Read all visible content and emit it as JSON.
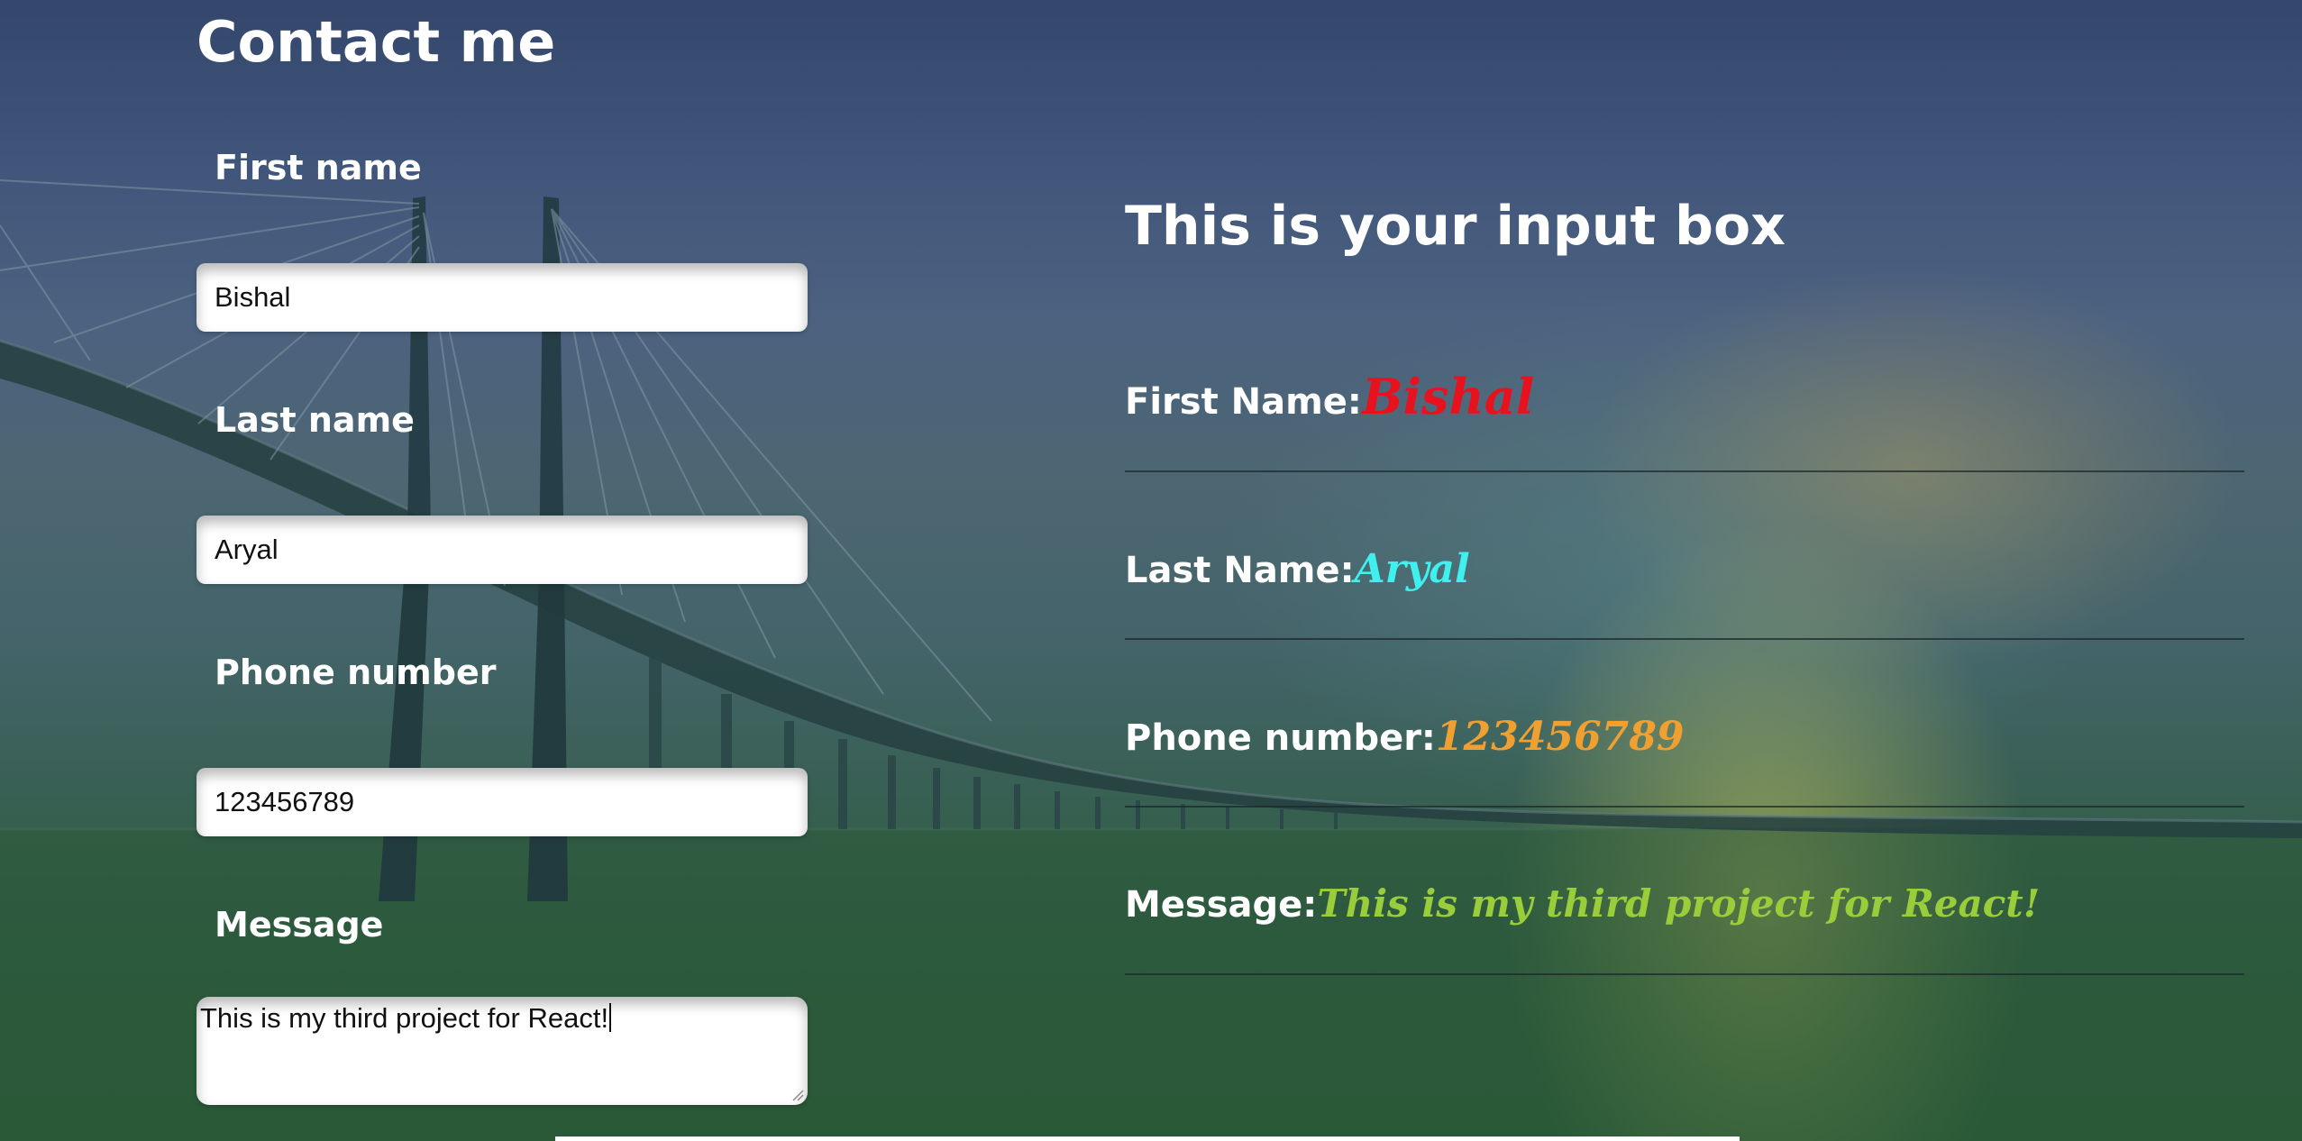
{
  "form": {
    "title": "Contact me",
    "first_name": {
      "label": "First name",
      "value": "Bishal"
    },
    "last_name": {
      "label": "Last name",
      "value": "Aryal"
    },
    "phone": {
      "label": "Phone number",
      "value": "123456789"
    },
    "message": {
      "label": "Message",
      "value": "This is my third project for React!"
    }
  },
  "preview": {
    "title": "This is your input box",
    "rows": [
      {
        "label": "First Name:",
        "value": "Bishal",
        "color": "#e8121f"
      },
      {
        "label": "Last Name:",
        "value": "Aryal",
        "color": "#3ff0ee"
      },
      {
        "label": "Phone number:",
        "value": "123456789",
        "color": "#f0a030"
      },
      {
        "label": "Message:",
        "value": "This is my third project for React!",
        "color": "#9acd3a"
      }
    ]
  },
  "icons": {
    "resize": "resize-grip-icon",
    "background": "bridge-background"
  }
}
